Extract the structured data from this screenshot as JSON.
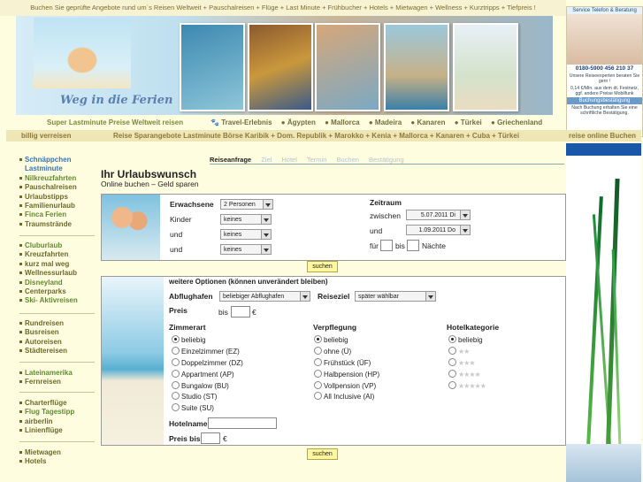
{
  "header": {
    "tagline": "Buchen Sie geprüfte Angebote rund um´s Reisen Weltweit + Pauschalreisen + Flüge + Last Minute + Frühbucher + Hotels + Mietwagen + Wellness + Kurztripps + Tiefpreis !",
    "logo": "Weg in die Ferien"
  },
  "service": {
    "title": "Service Telefon & Beratung",
    "phone": "0180-5900 456 210 37",
    "line1": "Unsere Reiseexperten beraten Sie gern !",
    "line2": "0,14 €/Min. aus dem dt. Festnetz, ggf. andere Preise Mobilfunk",
    "booking_title": "Buchungsbestätigung",
    "booking_text": "Nach Buchung erhalten Sie eine schriftliche Bestätigung."
  },
  "nav1": {
    "first": "Super Lastminute Preise Weltweit reisen",
    "items": [
      "Travel-Erlebnis",
      "Ägypten",
      "Mallorca",
      "Madeira",
      "Kanaren",
      "Türkei",
      "Griechenland"
    ]
  },
  "nav2": {
    "left": "billig verreisen",
    "middle": "Reise Sparangebote Lastminute Börse Karibik + Dom. Republik + Marokko + Kenia + Mallorca + Kanaren + Cuba + Türkei",
    "right": "reise online Buchen"
  },
  "leftmenu": {
    "g1": [
      "Schnäppchen",
      "Lastminute",
      "Nilkreuzfahrten",
      "Pauschalreisen",
      "Urlaubstipps",
      "Familienurlaub",
      "Finca Ferien",
      "Traumstrände"
    ],
    "g2": [
      "Cluburlaub",
      "Kreuzfahrten",
      "kurz mal weg",
      "Wellnessurlaub",
      "Disneyland",
      "Centerparks",
      "Ski- Aktivreisen"
    ],
    "g3": [
      "Rundreisen",
      "Busreisen",
      "Autoreisen",
      "Städtereisen"
    ],
    "g4": [
      "Lateinamerika",
      "Fernreisen"
    ],
    "g5": [
      "Charterflüge",
      "Flug Tagestipp",
      "airberlin",
      "Linienflüge"
    ],
    "g6": [
      "Mietwagen",
      "Hotels"
    ]
  },
  "steps": [
    "Reiseanfrage",
    "Ziel",
    "Hotel",
    "Termin",
    "Buchen",
    "Bestätigung"
  ],
  "page": {
    "title": "Ihr Urlaubswunsch",
    "subtitle": "Online buchen – Geld sparen"
  },
  "form1": {
    "adults_label": "Erwachsene",
    "adults_value": "2 Personen",
    "kinder_label": "Kinder",
    "kinder_value": "keines",
    "und1_label": "und",
    "und1_value": "keines",
    "und2_label": "und",
    "und2_value": "keines",
    "zeitraum_label": "Zeitraum",
    "zwischen_label": "zwischen",
    "date_from": "5.07.2011 Di",
    "und_label": "und",
    "date_to": "1.09.2011 Do",
    "fuer_label": "für",
    "bis_label": "bis",
    "naechte_label": "Nächte",
    "search_button": "suchen"
  },
  "form2": {
    "heading": "weitere Optionen (können unverändert bleiben)",
    "airport_label": "Abflughafen",
    "airport_value": "beliebiger Abflughafen",
    "destination_label": "Reiseziel",
    "destination_value": "später wählbar",
    "price_label": "Preis",
    "bis_label": "bis",
    "currency": "€",
    "zimmerart_label": "Zimmerart",
    "zimmerart": [
      "beliebig",
      "Einzelzimmer (EZ)",
      "Doppelzimmer (DZ)",
      "Appartment (AP)",
      "Bungalow (BU)",
      "Studio (ST)",
      "Suite (SU)"
    ],
    "verpflegung_label": "Verpflegung",
    "verpflegung": [
      "beliebig",
      "ohne (Ü)",
      "Frühstück (ÜF)",
      "Halbpension (HP)",
      "Vollpension (VP)",
      "All Inclusive (AI)"
    ],
    "hotelkat_label": "Hotelkategorie",
    "hotelkat_first": "beliebig",
    "hotelkat_stars": [
      "★★",
      "★★★",
      "★★★★",
      "★★★★★"
    ],
    "hotelname_label": "Hotelname",
    "preisbis_label": "Preis bis",
    "search_button": "suchen"
  }
}
